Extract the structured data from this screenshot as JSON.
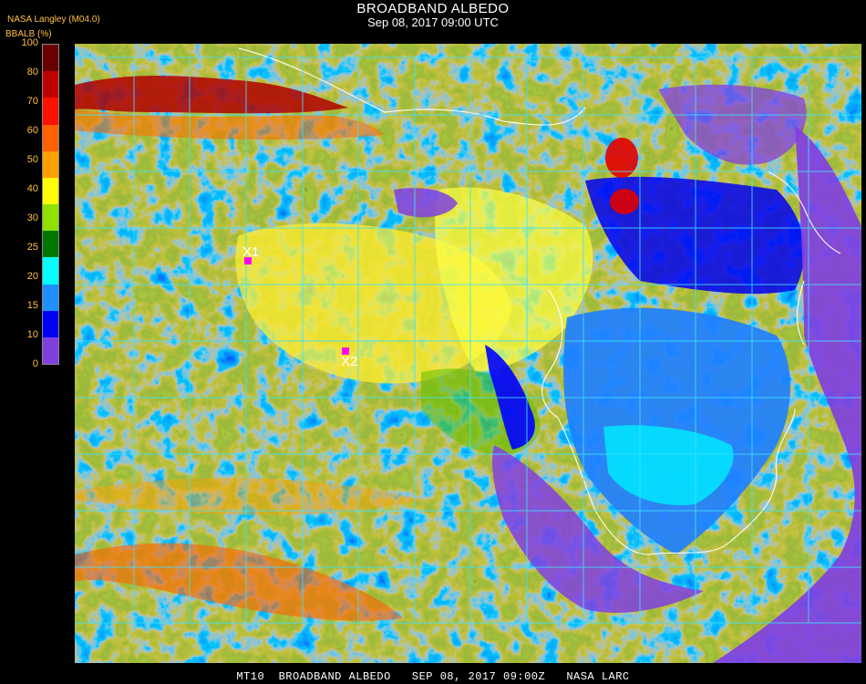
{
  "header": {
    "title": "BROADBAND ALBEDO",
    "datetime": "Sep 08, 2017 09:00 UTC",
    "producer": "NASA Langley (M04.0)"
  },
  "colorbar": {
    "title": "BBALB (%)",
    "ticks": [
      "100",
      "80",
      "70",
      "60",
      "50",
      "40",
      "30",
      "25",
      "20",
      "15",
      "10",
      "0"
    ],
    "colors": [
      "#6b0000",
      "#c00000",
      "#ff1000",
      "#ff6000",
      "#ffa000",
      "#ffff00",
      "#90e000",
      "#007800",
      "#00ffff",
      "#1e90ff",
      "#0000ff",
      "#8040e0"
    ]
  },
  "map": {
    "markers": [
      {
        "label": "X1",
        "color": "#ff00ff"
      },
      {
        "label": "X2",
        "color": "#ff00ff"
      }
    ],
    "grid_color": "#40e0ff",
    "coast_color": "#ffffff"
  },
  "footer": "MT10  BROADBAND ALBEDO   SEP 08, 2017 09:00Z   NASA LARC"
}
